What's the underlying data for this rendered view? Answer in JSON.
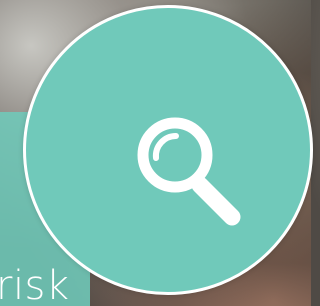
{
  "panel": {
    "word": "risk"
  },
  "search": {
    "icon": "search-icon",
    "accent_color": "#70c9ba",
    "icon_color": "#ffffff"
  }
}
